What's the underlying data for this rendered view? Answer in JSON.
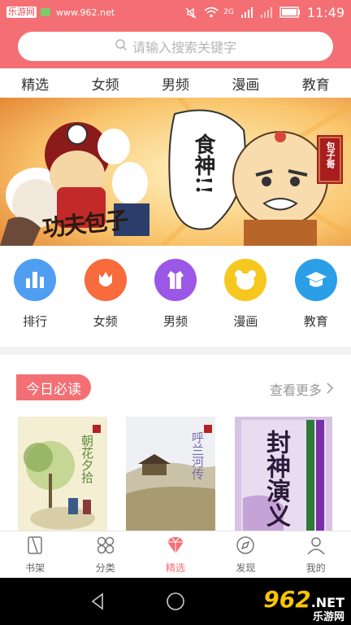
{
  "status_bar": {
    "app_badge": "乐游网",
    "site": "www.962.net",
    "network": "2G",
    "time": "11:49"
  },
  "search": {
    "placeholder": "请输入搜索关键字"
  },
  "tabs": [
    {
      "label": "精选",
      "active": true
    },
    {
      "label": "女频",
      "active": false
    },
    {
      "label": "男频",
      "active": false
    },
    {
      "label": "漫画",
      "active": false
    },
    {
      "label": "教育",
      "active": false
    }
  ],
  "banner": {
    "text_left": "功夫包子",
    "text_center": "食神!!",
    "tag": "包子哥"
  },
  "categories": [
    {
      "label": "排行",
      "color": "#4f9ef2",
      "icon": "ranking-icon"
    },
    {
      "label": "女频",
      "color": "#f86b3c",
      "icon": "tulip-icon"
    },
    {
      "label": "男频",
      "color": "#9b58e6",
      "icon": "shirt-icon"
    },
    {
      "label": "漫画",
      "color": "#f6c81f",
      "icon": "bear-icon"
    },
    {
      "label": "教育",
      "color": "#2a9fe8",
      "icon": "graduation-cap-icon"
    }
  ],
  "section": {
    "title": "今日必读",
    "more": "查看更多"
  },
  "books": [
    {
      "title": "朝花夕拾"
    },
    {
      "title": "呼兰河传"
    },
    {
      "title": "封神演义"
    }
  ],
  "bottom_nav": [
    {
      "label": "书架",
      "icon": "bookshelf-icon",
      "active": false
    },
    {
      "label": "分类",
      "icon": "category-icon",
      "active": false
    },
    {
      "label": "精选",
      "icon": "diamond-icon",
      "active": true
    },
    {
      "label": "发现",
      "icon": "compass-icon",
      "active": false
    },
    {
      "label": "我的",
      "icon": "profile-icon",
      "active": false
    }
  ],
  "watermark": {
    "number": "962",
    "suffix": ".NET",
    "brand": "乐游网"
  },
  "colors": {
    "accent": "#f36f74"
  }
}
